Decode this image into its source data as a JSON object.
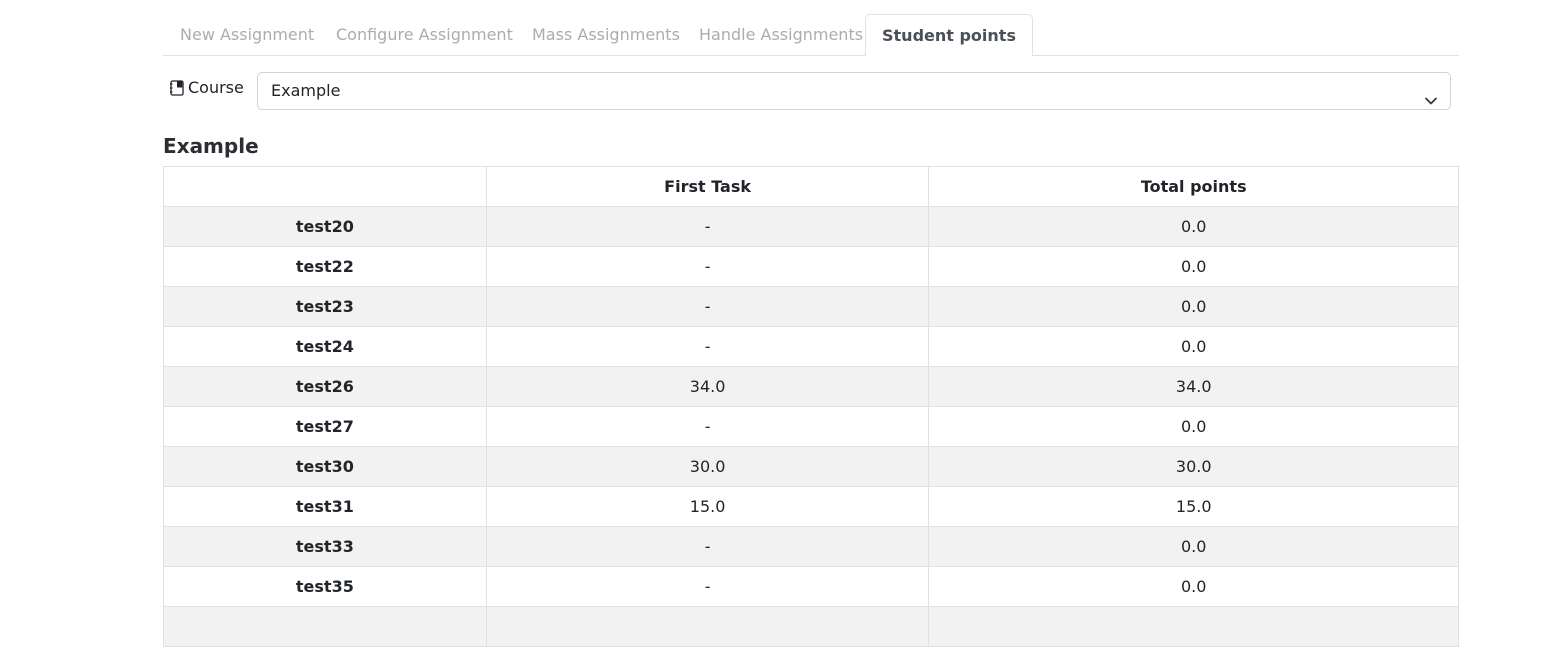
{
  "tabs": [
    {
      "label": "New Assignment",
      "active": false
    },
    {
      "label": "Configure Assignment",
      "active": false
    },
    {
      "label": "Mass Assignments",
      "active": false
    },
    {
      "label": "Handle Assignments",
      "active": false
    },
    {
      "label": "Student points",
      "active": true
    }
  ],
  "course": {
    "label": "Course",
    "icon": "book-icon",
    "selected": "Example"
  },
  "section_title": "Example",
  "table": {
    "headers": [
      "",
      "First Task",
      "Total points"
    ],
    "rows": [
      {
        "name": "test20",
        "first_task": "-",
        "total": "0.0"
      },
      {
        "name": "test22",
        "first_task": "-",
        "total": "0.0"
      },
      {
        "name": "test23",
        "first_task": "-",
        "total": "0.0"
      },
      {
        "name": "test24",
        "first_task": "-",
        "total": "0.0"
      },
      {
        "name": "test26",
        "first_task": "34.0",
        "total": "34.0"
      },
      {
        "name": "test27",
        "first_task": "-",
        "total": "0.0"
      },
      {
        "name": "test30",
        "first_task": "30.0",
        "total": "30.0"
      },
      {
        "name": "test31",
        "first_task": "15.0",
        "total": "15.0"
      },
      {
        "name": "test33",
        "first_task": "-",
        "total": "0.0"
      },
      {
        "name": "test35",
        "first_task": "-",
        "total": "0.0"
      }
    ]
  },
  "colors": {
    "accent_text": "#495057",
    "muted_tab": "#a9adb1",
    "stripe": "#f2f2f2",
    "border": "#dee2e6"
  }
}
